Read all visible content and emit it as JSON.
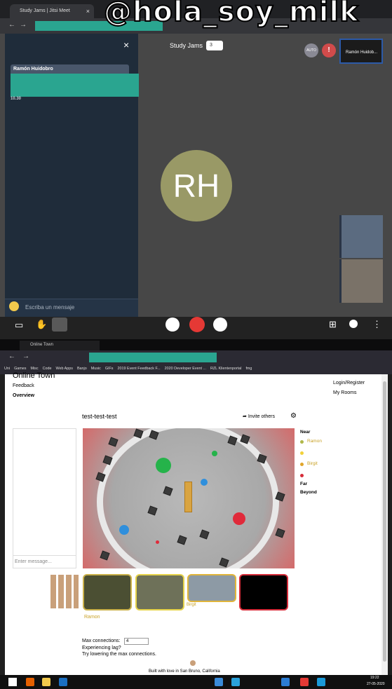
{
  "watermark": "@hola_soy_milk",
  "top_browser": {
    "tab_title": "Study Jams | Jitsi Meet",
    "tab_close": "×"
  },
  "jitsi": {
    "meeting_title": "Study Jams",
    "participant_count": "3",
    "chat": {
      "close": "×",
      "sender": "Ramón Huidobro",
      "time": "10.30",
      "placeholder": "Escriba un mensaje"
    },
    "avatar_initials": "RH",
    "badge_auto": "AUTO",
    "warning": "!",
    "thumb_name": "Ramón Huidob...",
    "colors": {
      "avatar": "#999966",
      "chat_bg": "#1f2c3a",
      "end_call": "#e53935"
    }
  },
  "bottom_browser": {
    "tab_title": "Online Town",
    "bookmarks": [
      "Uni",
      "Games",
      "Misc",
      "Code",
      "Web Apps",
      "Banjo",
      "Music",
      "GIFs",
      "2019 Event Feedback F...",
      "2020 Developer Event ...",
      "RZL Klientenportal",
      "fmg"
    ]
  },
  "online_town": {
    "app_name": "Online Town",
    "feedback": "Feedback",
    "overview": "Overview",
    "login": "Login/Register",
    "my_rooms": "My Rooms",
    "room_name": "test-test-test",
    "invite": "Invite others",
    "message_placeholder": "Enter message...",
    "legend": {
      "near_title": "Near",
      "near": [
        {
          "name": "Ramon",
          "color": "#b0b84a"
        },
        {
          "name": "",
          "color": "#f2d13a"
        },
        {
          "name": "Birgit",
          "color": "#e0a52a"
        }
      ],
      "far_dot_color": "#d62d3a",
      "far": "Far",
      "beyond": "Beyond"
    },
    "video_labels": [
      "Ramon",
      "Birgit"
    ],
    "max_connections_label": "Max connections:",
    "max_connections_value": "4",
    "lag_1": "Experiencing lag?",
    "lag_2": "Try lowering the max connections.",
    "footer": "Built with love in San Bruno, California"
  },
  "taskbar": {
    "time": "19:22",
    "date": "27-05-2020"
  }
}
